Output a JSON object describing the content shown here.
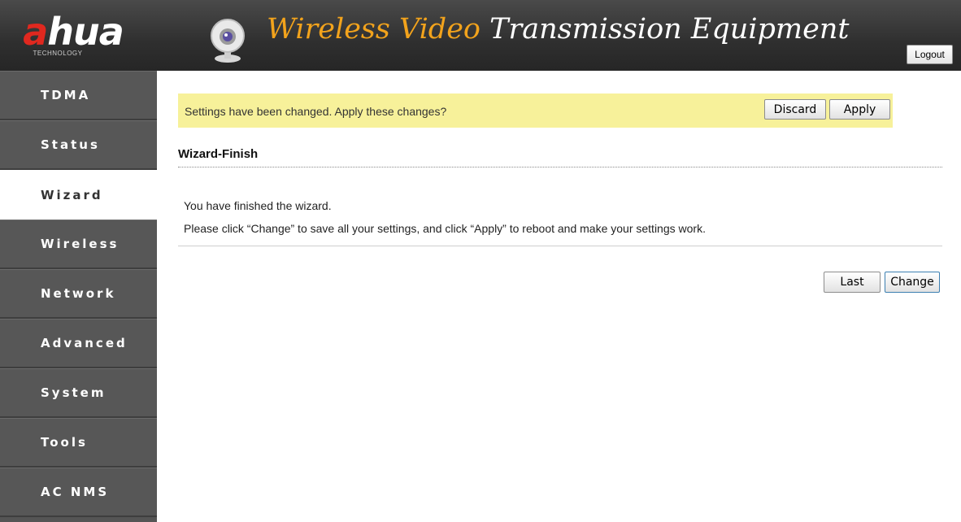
{
  "header": {
    "logo_text_red": "a",
    "logo_text_white": "hua",
    "logo_sub": "TECHNOLOGY",
    "title_orange": "Wireless Video",
    "title_white": "Transmission Equipment",
    "logout_label": "Logout",
    "icon": "webcam-icon"
  },
  "sidebar": {
    "items": [
      {
        "label": "TDMA",
        "active": false
      },
      {
        "label": "Status",
        "active": false
      },
      {
        "label": "Wizard",
        "active": true
      },
      {
        "label": "Wireless",
        "active": false
      },
      {
        "label": "Network",
        "active": false
      },
      {
        "label": "Advanced",
        "active": false
      },
      {
        "label": "System",
        "active": false
      },
      {
        "label": "Tools",
        "active": false
      },
      {
        "label": "AC NMS",
        "active": false
      }
    ]
  },
  "notify": {
    "message": "Settings have been changed. Apply these changes?",
    "discard_label": "Discard",
    "apply_label": "Apply"
  },
  "main": {
    "section_title": "Wizard-Finish",
    "line1": "You have finished the wizard.",
    "line2": "Please click “Change” to save all your settings, and click “Apply” to reboot and make your settings work.",
    "last_label": "Last",
    "change_label": "Change"
  },
  "colors": {
    "header_bg": "#2f2f2f",
    "sidebar_bg": "#575757",
    "notify_bg": "#f7f19a",
    "title_orange": "#f2a31c",
    "logo_red": "#e0281f"
  }
}
